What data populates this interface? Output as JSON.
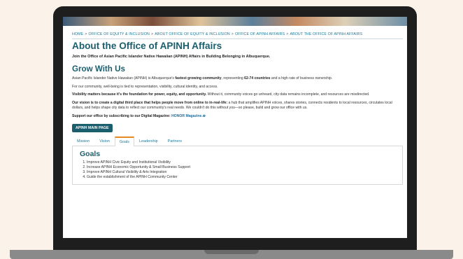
{
  "breadcrumb": [
    "HOME",
    "OFFICE OF EQUITY & INCLUSION",
    "ABOUT OFFICE OF EQUITY & INCLUSION",
    "OFFICE OF APINH AFFAIRS",
    "ABOUT THE OFFICE OF APINH AFFAIRS"
  ],
  "breadcrumb_sep": ">",
  "page_title": "About the Office of APINH Affairs",
  "intro": "Join the Office of Asian Pacific Islander Native Hawaiian (APINH) Affairs in Building Belonging in Albuquerque.",
  "section_title": "Grow With Us",
  "paragraphs": {
    "p1_a": "Asian Pacific Islander Native Hawaiian (APINH) is Albuquerque's ",
    "p1_b": "fastest growing community",
    "p1_c": ", representing ",
    "p1_d": "62-74 countries",
    "p1_e": " and a high rate of business ownership.",
    "p2": "For our community, well-being is tied to representation, visibility, cultural identity, and access.",
    "p3_a": "Visibility matters because it's the foundation for power, equity, and opportunity.",
    "p3_b": " Without it, community voices go unheard, city data remains incomplete, and resources are misdirected.",
    "p4_a": "Our vision is to create a digital third place that helps people move from online to in-real-life:",
    "p4_b": " a hub that amplifies APINH voices, shares stories, connects residents to local resources, circulates local dollars, and helps shape city data to reflect our community's real needs. We couldn't do this without you—so please, build and grow our office with us.",
    "p5_a": "Support our office by subscribing to our Digital Magazine: ",
    "p5_link": "HONOR Magazine.",
    "p5_icon": "⊕"
  },
  "main_button": "APINH MAIN PAGE",
  "tabs": [
    "Mission",
    "Vision",
    "Goals",
    "Leadership",
    "Partners"
  ],
  "active_tab": "Goals",
  "panel": {
    "title": "Goals",
    "items": [
      "Improve APINH Civic Equity and Institutional Visibility",
      "Increase APINH Economic Opportunity & Small Business Support",
      "Improve APINH Cultural Visibility & Arts Integration",
      "Guide the establishment of the APINH Community Center"
    ]
  },
  "colors": {
    "accent": "#1b5e6e",
    "link": "#1a7a9a",
    "active_tab_border": "#e58a1f",
    "background": "#fbf3ea"
  }
}
